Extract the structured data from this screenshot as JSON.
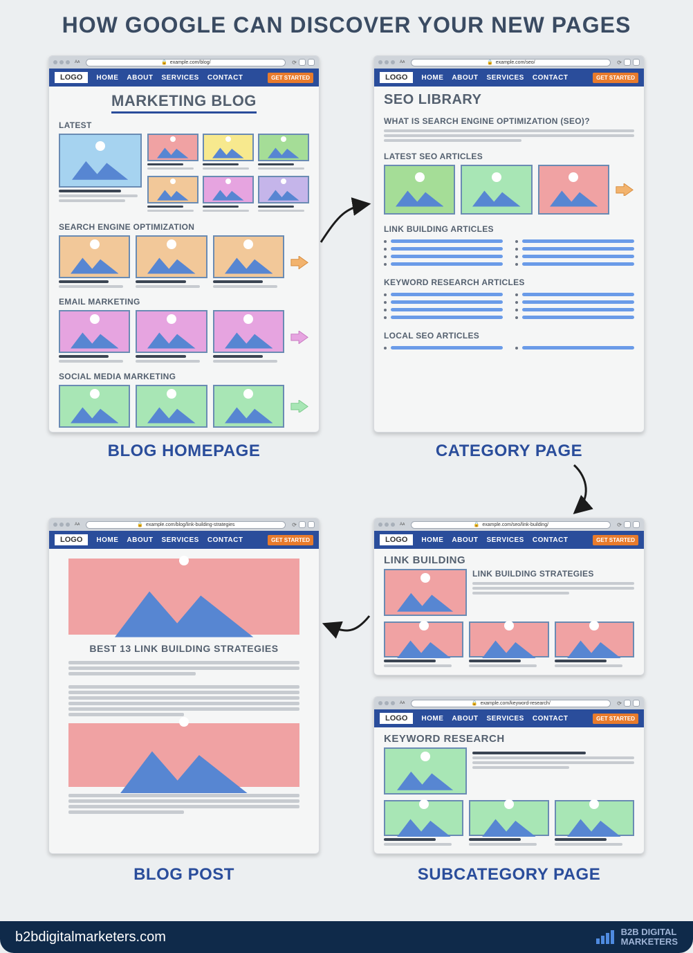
{
  "title": "HOW GOOGLE CAN DISCOVER YOUR NEW PAGES",
  "nav": {
    "logo": "LOGO",
    "items": [
      "HOME",
      "ABOUT",
      "SERVICES",
      "CONTACT"
    ],
    "cta": "GET STARTED"
  },
  "cards": {
    "blog_home": {
      "url": "example.com/blog/",
      "title": "MARKETING BLOG",
      "sections": {
        "latest": "LATEST",
        "seo": "SEARCH ENGINE OPTIMIZATION",
        "email": "EMAIL MARKETING",
        "social": "SOCIAL MEDIA MARKETING"
      },
      "caption": "BLOG HOMEPAGE"
    },
    "category": {
      "url": "example.com/seo/",
      "title": "SEO LIBRARY",
      "sections": {
        "what": "WHAT IS SEARCH ENGINE OPTIMIZATION (SEO)?",
        "latest": "LATEST SEO ARTICLES",
        "link": "LINK BUILDING ARTICLES",
        "kw": "KEYWORD RESEARCH ARTICLES",
        "local": "LOCAL SEO ARTICLES"
      },
      "caption": "CATEGORY PAGE"
    },
    "sub1": {
      "url": "example.com/seo/link-building/",
      "title": "LINK BUILDING",
      "subtitle": "LINK BUILDING STRATEGIES"
    },
    "sub2": {
      "url": "example.com/keyword-research/",
      "title": "KEYWORD RESEARCH"
    },
    "subcaption": "SUBCATEGORY PAGE",
    "post": {
      "url": "example.com/blog/link-building-strategies",
      "title": "BEST 13 LINK BUILDING STRATEGIES",
      "caption": "BLOG POST"
    }
  },
  "footer": {
    "domain": "b2bdigitalmarketers.com",
    "brand1": "B2B DIGITAL",
    "brand2": "MARKETERS"
  }
}
